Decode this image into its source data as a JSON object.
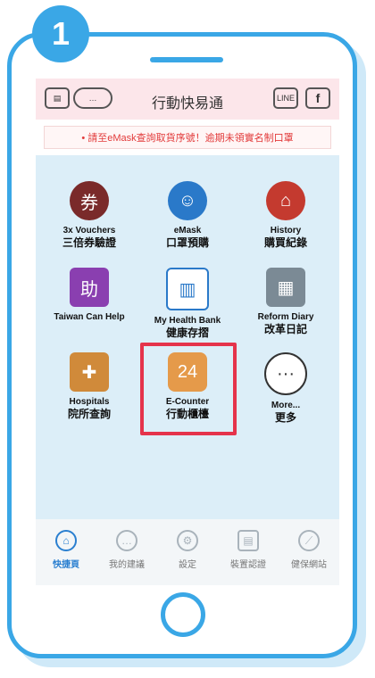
{
  "step_badge": "1",
  "app": {
    "title": "行動快易通",
    "header_left_icons": [
      "newspaper-icon",
      "chat-bubbles-icon"
    ],
    "header_right_icons": [
      {
        "name": "line-icon",
        "label": "LINE"
      },
      {
        "name": "facebook-icon",
        "label": "f"
      }
    ],
    "banner_text": "• 請至eMask查詢取貨序號！逾期未領實名制口罩"
  },
  "tiles": [
    {
      "id": "vouchers",
      "en": "3x Vouchers",
      "zh": "三倍券驗證",
      "icon": "vouchers-icon",
      "color": "#7a2a2a"
    },
    {
      "id": "emask",
      "en": "eMask",
      "zh": "口罩預購",
      "icon": "mask-icon",
      "color": "#2a79c9"
    },
    {
      "id": "history",
      "en": "History",
      "zh": "購買紀錄",
      "icon": "history-icon",
      "color": "#c43a2f"
    },
    {
      "id": "taiwan-can-help",
      "en": "Taiwan Can Help",
      "zh": "",
      "icon": "help-icon",
      "color": "#8a3fb0"
    },
    {
      "id": "health-bank",
      "en": "My Health Bank",
      "zh": "健康存摺",
      "icon": "health-bank-icon",
      "color": "#2a79c9"
    },
    {
      "id": "reform-diary",
      "en": "Reform Diary",
      "zh": "改革日記",
      "icon": "diary-icon",
      "color": "#7b8a95"
    },
    {
      "id": "hospitals",
      "en": "Hospitals",
      "zh": "院所查詢",
      "icon": "hospital-icon",
      "color": "#d08a3a"
    },
    {
      "id": "e-counter",
      "en": "E-Counter",
      "zh": "行動櫃檯",
      "icon": "counter-icon",
      "color": "#e59a4a"
    },
    {
      "id": "more",
      "en": "More...",
      "zh": "更多",
      "icon": "more-icon",
      "color": "#333333"
    }
  ],
  "tabbar": [
    {
      "label": "快捷頁",
      "icon": "home-icon",
      "active": true
    },
    {
      "label": "我的建議",
      "icon": "chat-icon",
      "active": false
    },
    {
      "label": "設定",
      "icon": "settings-icon",
      "active": false
    },
    {
      "label": "裝置認證",
      "icon": "device-icon",
      "active": false
    },
    {
      "label": "健保網站",
      "icon": "compass-icon",
      "active": false
    }
  ],
  "colors": {
    "accent": "#3aa7e6",
    "highlight": "#e5334b",
    "header_bg": "#fce6ea",
    "active_tab": "#2a7fd0"
  }
}
